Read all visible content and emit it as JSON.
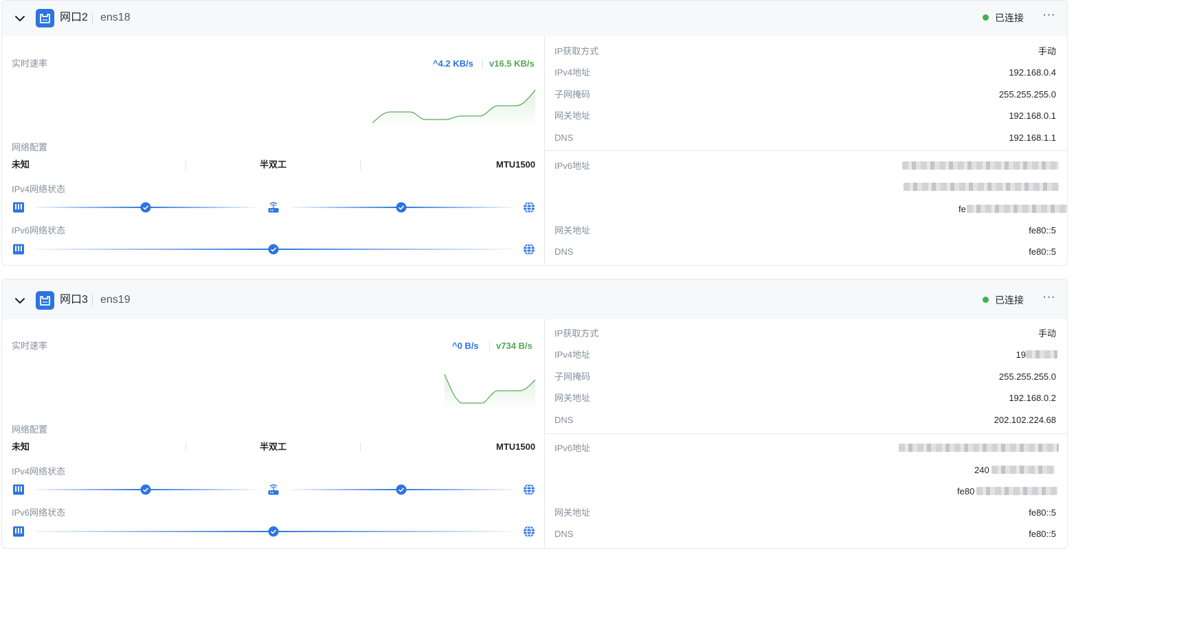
{
  "colors": {
    "accent": "#2b74e2",
    "connected": "#3fb34f",
    "download": "#52a852"
  },
  "ports": [
    {
      "name": "网口2",
      "ifname": "ens18",
      "status": "已连接",
      "more": "···",
      "speed_label": "实时速率",
      "upload": "4.2 KB/s",
      "download": "16.5 KB/s",
      "net_config_label": "网络配置",
      "config": [
        "未知",
        "半双工",
        "MTU1500"
      ],
      "ipv4_status_label": "IPv4网络状态",
      "ipv6_status_label": "IPv6网络状态",
      "ipv4_rows": [
        {
          "label": "IP获取方式",
          "value": "手动"
        },
        {
          "label": "IPv4地址",
          "value": "192.168.0.4"
        },
        {
          "label": "子网掩码",
          "value": "255.255.255.0"
        },
        {
          "label": "网关地址",
          "value": "192.168.0.1"
        },
        {
          "label": "DNS",
          "value": "192.168.1.1"
        }
      ],
      "ipv6_label": "IPv6地址",
      "ipv6_visible": [
        "",
        "",
        "fe"
      ],
      "ipv6_rows": [
        {
          "label": "网关地址",
          "value": "fe80::5"
        },
        {
          "label": "DNS",
          "value": "fe80::5"
        }
      ]
    },
    {
      "name": "网口3",
      "ifname": "ens19",
      "status": "已连接",
      "more": "···",
      "speed_label": "实时速率",
      "upload": "0 B/s",
      "download": "734 B/s",
      "net_config_label": "网络配置",
      "config": [
        "未知",
        "半双工",
        "MTU1500"
      ],
      "ipv4_status_label": "IPv4网络状态",
      "ipv6_status_label": "IPv6网络状态",
      "ipv4_rows": [
        {
          "label": "IP获取方式",
          "value": "手动"
        },
        {
          "label": "IPv4地址",
          "value": "19"
        },
        {
          "label": "子网掩码",
          "value": "255.255.255.0"
        },
        {
          "label": "网关地址",
          "value": "192.168.0.2"
        },
        {
          "label": "DNS",
          "value": "202.102.224.68"
        }
      ],
      "ipv6_label": "IPv6地址",
      "ipv6_visible": [
        "",
        "240",
        "fe80"
      ],
      "ipv6_rows": [
        {
          "label": "网关地址",
          "value": "fe80::5"
        },
        {
          "label": "DNS",
          "value": "fe80::5"
        }
      ]
    }
  ]
}
